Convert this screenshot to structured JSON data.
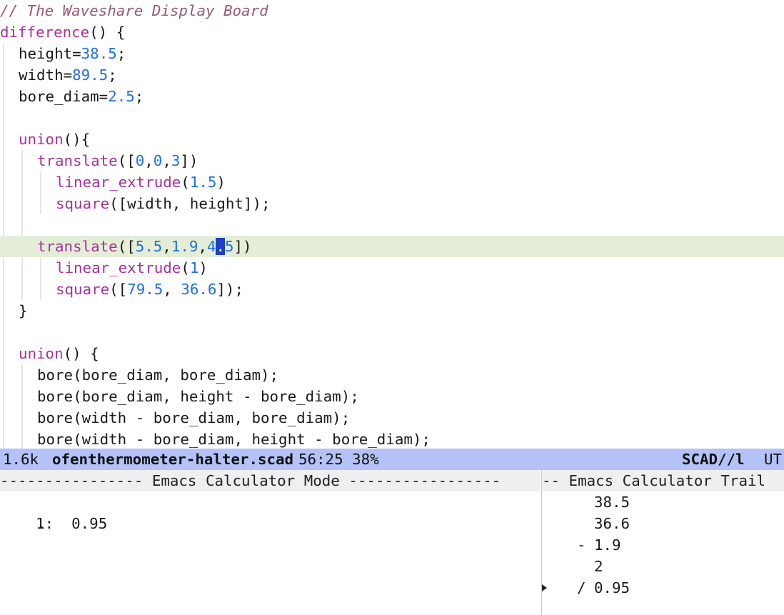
{
  "editor": {
    "lines": [
      {
        "guides": 0,
        "tokens": [
          {
            "t": "// The Waveshare Display Board",
            "c": "comment"
          }
        ]
      },
      {
        "guides": 0,
        "tokens": [
          {
            "t": "difference",
            "c": "kw"
          },
          {
            "t": "() {",
            "c": "plain"
          }
        ]
      },
      {
        "guides": 1,
        "tokens": [
          {
            "t": "height=",
            "c": "plain"
          },
          {
            "t": "38.5",
            "c": "num"
          },
          {
            "t": ";",
            "c": "plain"
          }
        ]
      },
      {
        "guides": 1,
        "tokens": [
          {
            "t": "width=",
            "c": "plain"
          },
          {
            "t": "89.5",
            "c": "num"
          },
          {
            "t": ";",
            "c": "plain"
          }
        ]
      },
      {
        "guides": 1,
        "tokens": [
          {
            "t": "bore_diam=",
            "c": "plain"
          },
          {
            "t": "2.5",
            "c": "num"
          },
          {
            "t": ";",
            "c": "plain"
          }
        ]
      },
      {
        "guides": 1,
        "tokens": []
      },
      {
        "guides": 1,
        "tokens": [
          {
            "t": "union",
            "c": "kw"
          },
          {
            "t": "(){",
            "c": "plain"
          }
        ]
      },
      {
        "guides": 2,
        "tokens": [
          {
            "t": "translate",
            "c": "kw"
          },
          {
            "t": "([",
            "c": "plain"
          },
          {
            "t": "0",
            "c": "num"
          },
          {
            "t": ",",
            "c": "plain"
          },
          {
            "t": "0",
            "c": "num"
          },
          {
            "t": ",",
            "c": "plain"
          },
          {
            "t": "3",
            "c": "num"
          },
          {
            "t": "])",
            "c": "plain"
          }
        ]
      },
      {
        "guides": 3,
        "tokens": [
          {
            "t": "linear_extrude",
            "c": "kw"
          },
          {
            "t": "(",
            "c": "plain"
          },
          {
            "t": "1.5",
            "c": "num"
          },
          {
            "t": ")",
            "c": "plain"
          }
        ]
      },
      {
        "guides": 3,
        "tokens": [
          {
            "t": "square",
            "c": "kw"
          },
          {
            "t": "([width, height]);",
            "c": "plain"
          }
        ]
      },
      {
        "guides": 2,
        "tokens": []
      },
      {
        "guides": 2,
        "highlight": true,
        "tokens": [
          {
            "t": "translate",
            "c": "kw"
          },
          {
            "t": "([",
            "c": "plain"
          },
          {
            "t": "5.5",
            "c": "num"
          },
          {
            "t": ",",
            "c": "plain"
          },
          {
            "t": "1.9",
            "c": "num"
          },
          {
            "t": ",",
            "c": "plain"
          },
          {
            "t": "4",
            "c": "num"
          },
          {
            "t": ".",
            "c": "cursor"
          },
          {
            "t": "5",
            "c": "num"
          },
          {
            "t": "])",
            "c": "plain"
          }
        ]
      },
      {
        "guides": 3,
        "tokens": [
          {
            "t": "linear_extrude",
            "c": "kw"
          },
          {
            "t": "(",
            "c": "plain"
          },
          {
            "t": "1",
            "c": "num"
          },
          {
            "t": ")",
            "c": "plain"
          }
        ]
      },
      {
        "guides": 3,
        "tokens": [
          {
            "t": "square",
            "c": "kw"
          },
          {
            "t": "([",
            "c": "plain"
          },
          {
            "t": "79.5",
            "c": "num"
          },
          {
            "t": ", ",
            "c": "plain"
          },
          {
            "t": "36.6",
            "c": "num"
          },
          {
            "t": "]);",
            "c": "plain"
          }
        ]
      },
      {
        "guides": 1,
        "tokens": [
          {
            "t": "}",
            "c": "plain"
          }
        ]
      },
      {
        "guides": 1,
        "tokens": []
      },
      {
        "guides": 1,
        "tokens": [
          {
            "t": "union",
            "c": "kw"
          },
          {
            "t": "() {",
            "c": "plain"
          }
        ]
      },
      {
        "guides": 2,
        "tokens": [
          {
            "t": "bore(bore_diam, bore_diam);",
            "c": "plain"
          }
        ]
      },
      {
        "guides": 2,
        "tokens": [
          {
            "t": "bore(bore_diam, height - bore_diam);",
            "c": "plain"
          }
        ]
      },
      {
        "guides": 2,
        "tokens": [
          {
            "t": "bore(width - bore_diam, bore_diam);",
            "c": "plain"
          }
        ]
      },
      {
        "guides": 2,
        "tokens": [
          {
            "t": "bore(width - bore_diam, height - bore_diam);",
            "c": "plain"
          }
        ]
      }
    ]
  },
  "modeline": {
    "size": "1.6k",
    "filename": "ofenthermometer-halter.scad",
    "position": "56:25 38%",
    "mode": "SCAD//l",
    "encoding": "UT"
  },
  "calc": {
    "header": "---------------- Emacs Calculator Mode -----------------",
    "stack": [
      {
        "label": "1:",
        "value": "0.95"
      }
    ],
    "dot": "."
  },
  "trail": {
    "header": "-- Emacs Calculator Trail",
    "entries": [
      {
        "op": "",
        "value": "38.5",
        "current": false
      },
      {
        "op": "",
        "value": "36.6",
        "current": false
      },
      {
        "op": "-",
        "value": "1.9",
        "current": false
      },
      {
        "op": "",
        "value": "2",
        "current": false
      },
      {
        "op": "/",
        "value": "0.95",
        "current": true
      }
    ]
  }
}
